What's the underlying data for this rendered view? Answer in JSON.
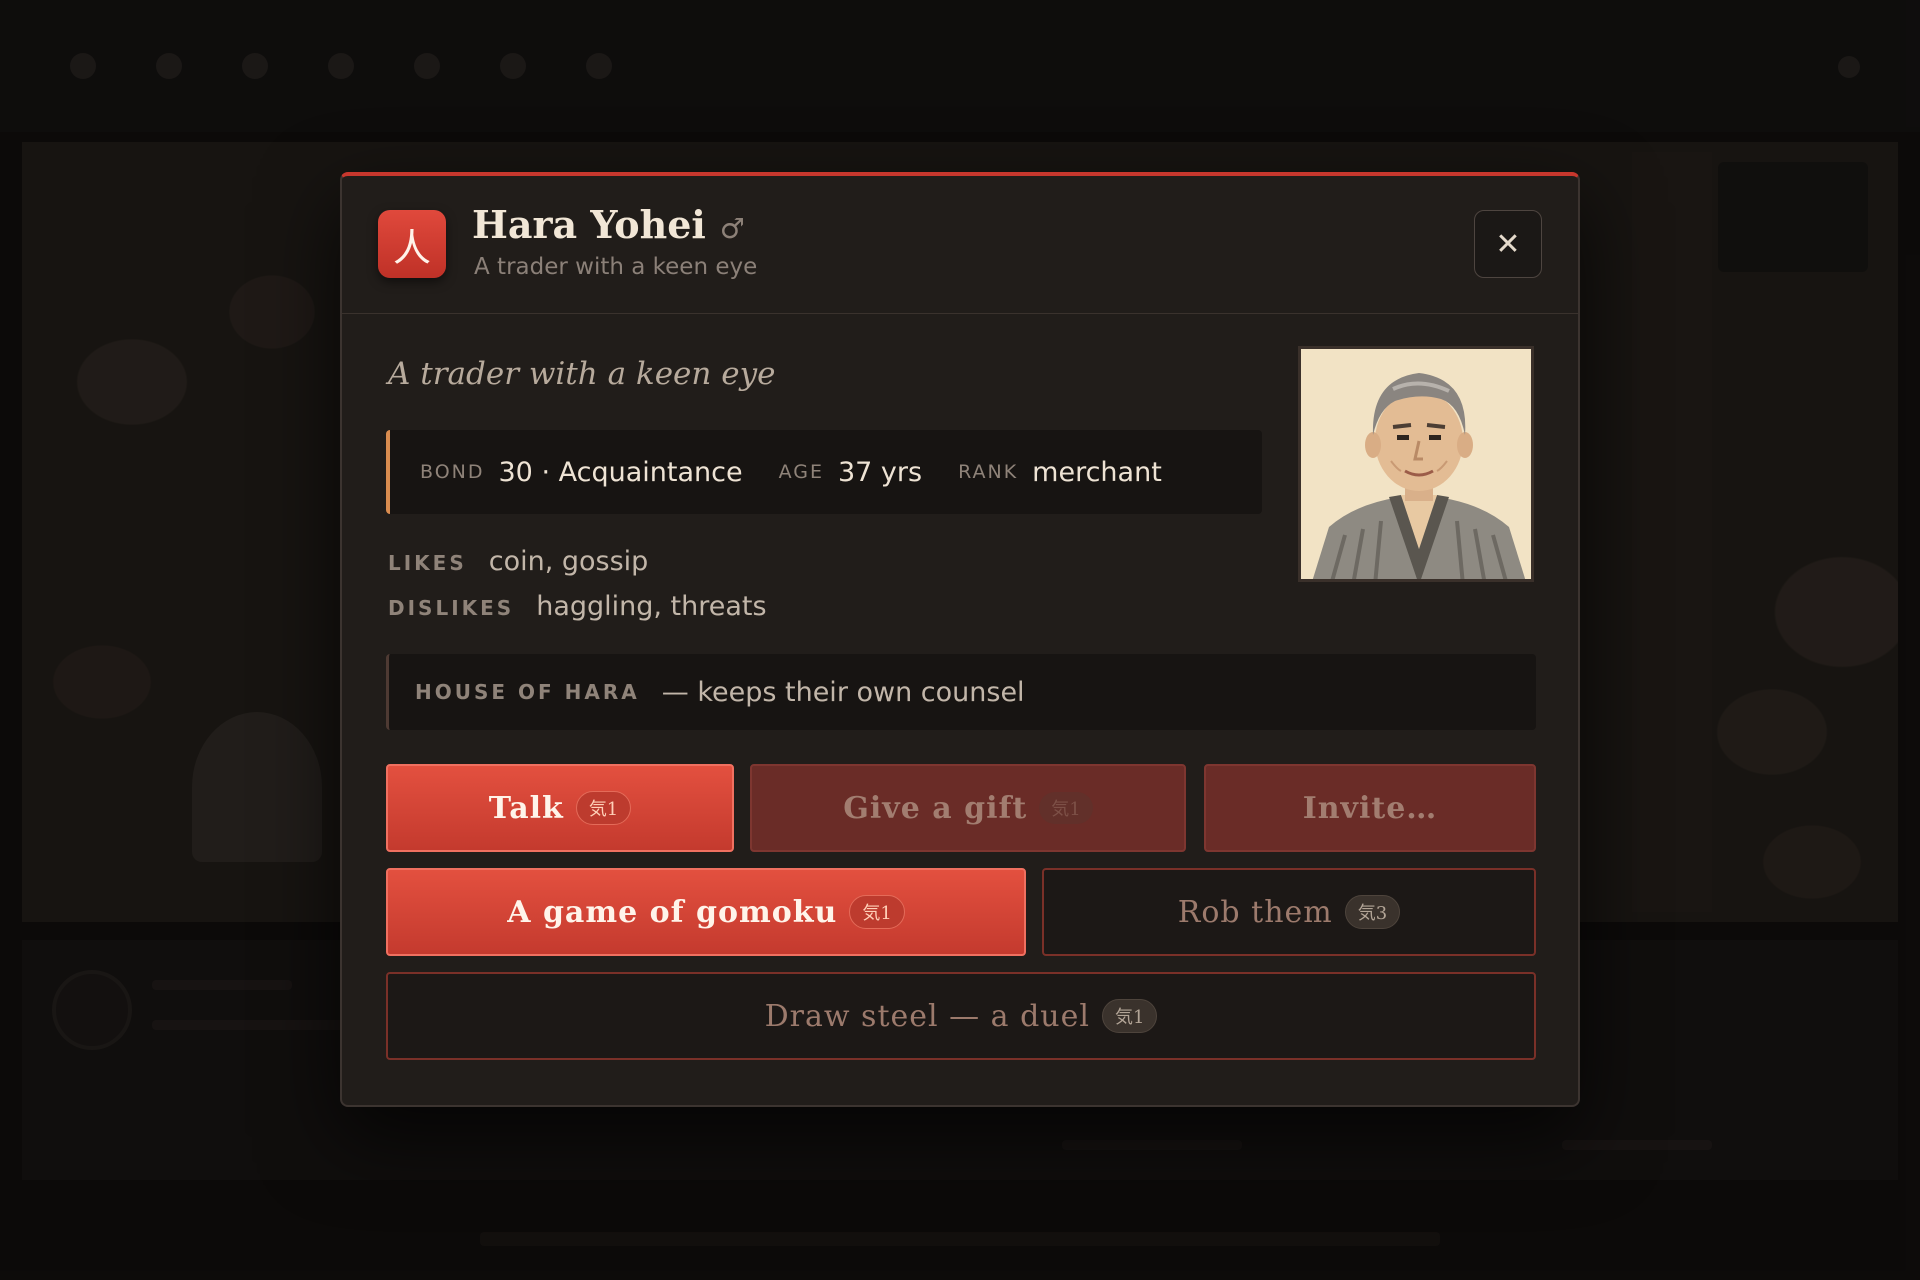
{
  "modal": {
    "emblem": "人",
    "name": "Hara Yohei",
    "gender_symbol": "♂",
    "subtitle": "A trader with a keen eye",
    "close_symbol": "✕",
    "flavor": "A trader with a keen eye",
    "stats": {
      "bond_label": "BOND",
      "bond_value": "30 · Acquaintance",
      "age_label": "AGE",
      "age_value": "37 yrs",
      "rank_label": "RANK",
      "rank_value": "merchant"
    },
    "likes_label": "LIKES",
    "likes_value": "coin, gossip",
    "dislikes_label": "DISLIKES",
    "dislikes_value": "haggling, threats",
    "house_name": "HOUSE OF HARA",
    "house_text": "— keeps their own counsel",
    "actions": [
      {
        "label": "Talk",
        "cost": "気1"
      },
      {
        "label": "Give a gift",
        "cost": "気1"
      },
      {
        "label": "Invite…",
        "cost": ""
      },
      {
        "label": "A game of gomoku",
        "cost": "気1"
      },
      {
        "label": "Rob them",
        "cost": "気3"
      },
      {
        "label": "Draw steel — a duel",
        "cost": "気1"
      }
    ]
  },
  "colors": {
    "accent": "#c7372d",
    "primary_button": "#e3503f",
    "muted_button": "#6a2c27",
    "panel": "#211d1a",
    "stat_highlight": "#d98c4f"
  },
  "icons": {
    "emblem": "person-kanji-icon",
    "gender": "male-symbol-icon",
    "close": "close-icon",
    "portrait": "character-portrait"
  }
}
